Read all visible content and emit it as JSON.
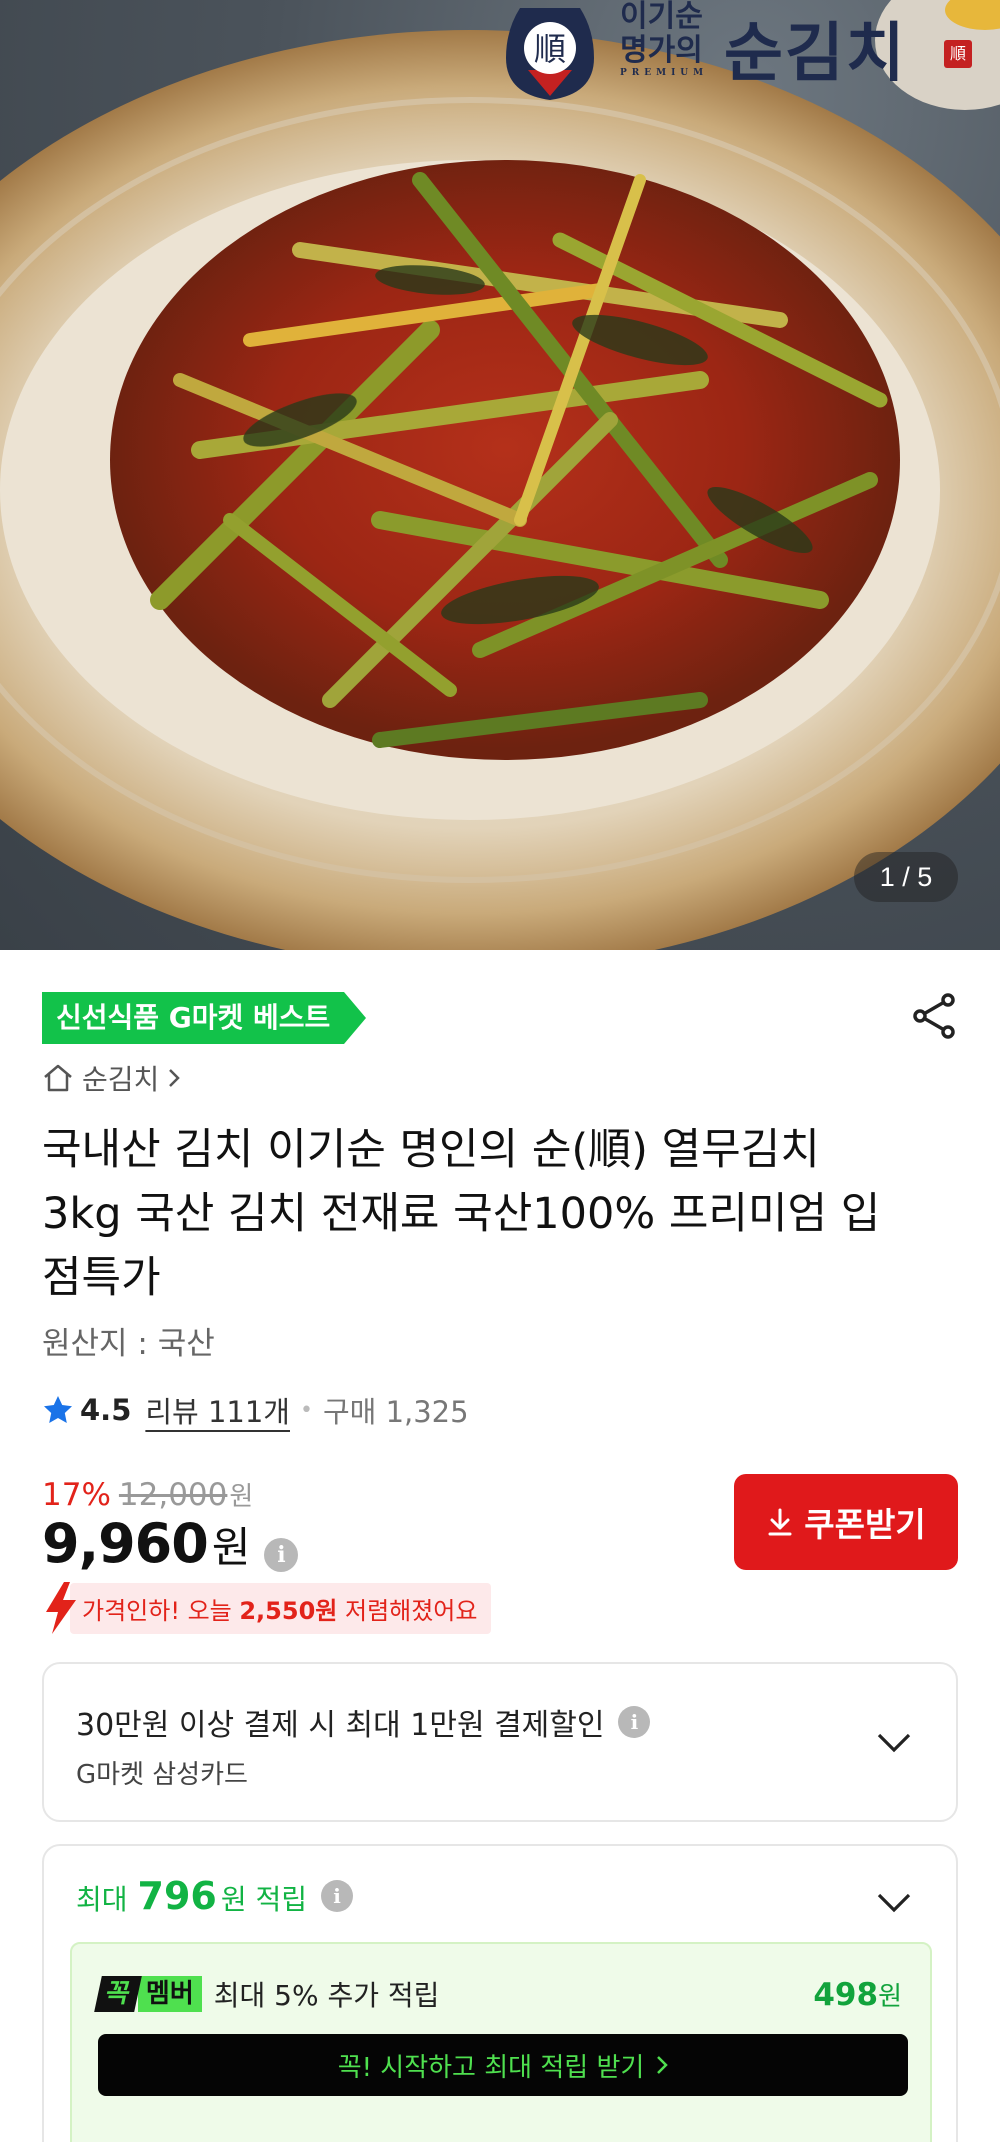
{
  "hero": {
    "brand_small_line1": "이기순",
    "brand_small_line2": "명가의",
    "brand_name": "순김치",
    "brand_jar_char": "順",
    "brand_seal_char": "順",
    "brand_premium": "PREMIUM",
    "image_counter": "1 / 5"
  },
  "badge": {
    "label": "신선식품 G마켓 베스트",
    "color": "#12c24a"
  },
  "share_icon": "share-icon",
  "breadcrumb": {
    "icon": "home-icon",
    "label": "순김치"
  },
  "product": {
    "title": "국내산 김치 이기순 명인의 순(順) 열무김치 3kg 국산 김치 전재료 국산100% 프리미엄 입점특가",
    "origin": "원산지 : 국산"
  },
  "rating": {
    "score": "4.5",
    "reviews": "리뷰 111개",
    "purchases": "구매 1,325"
  },
  "price": {
    "discount_rate": "17%",
    "original": "12,000",
    "original_unit": "원",
    "current": "9,960",
    "unit": "원",
    "info_icon": "i",
    "accent": "#e2231a"
  },
  "coupon": {
    "label": "쿠폰받기",
    "color": "#e0191b"
  },
  "price_drop": {
    "prefix": "가격인하! 오늘 ",
    "amount": "2,550원",
    "suffix": " 저렴해졌어요"
  },
  "payment_discount": {
    "title": "30만원 이상 결제 시 최대 1만원 결제할인",
    "card": "G마켓 삼성카드"
  },
  "points": {
    "prefix": "최대",
    "amount": "796",
    "suffix": "원 적립",
    "member_logo_a": "꼭",
    "member_logo_b": "멤버",
    "member_text": "최대 5% 추가 적립",
    "member_amount": "498",
    "member_unit": "원",
    "cta": "꼭! 시작하고 최대 적립 받기"
  }
}
